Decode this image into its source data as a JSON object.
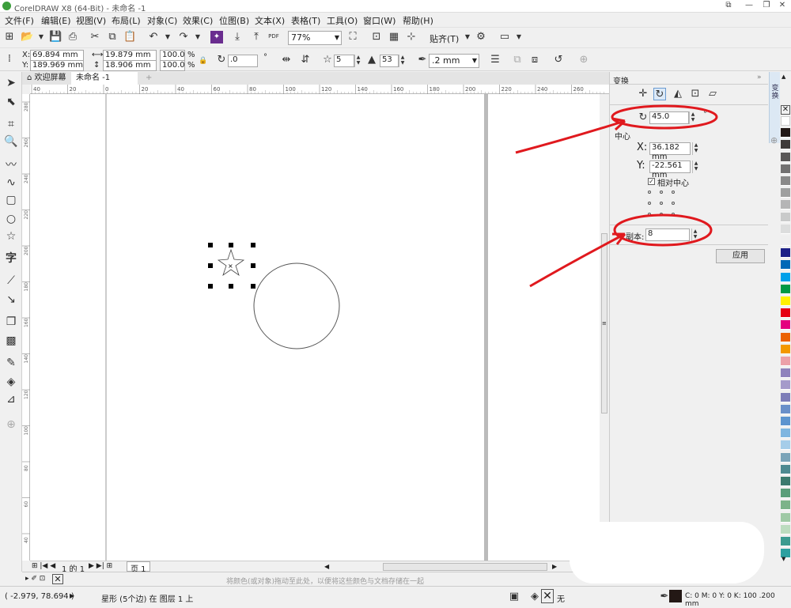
{
  "window": {
    "title": "CorelDRAW X8 (64-Bit) - 未命名 -1",
    "controls": [
      "⧉",
      "—",
      "❐",
      "✕"
    ]
  },
  "menu": {
    "items": [
      "文件(F)",
      "编辑(E)",
      "视图(V)",
      "布局(L)",
      "对象(C)",
      "效果(C)",
      "位图(B)",
      "文本(X)",
      "表格(T)",
      "工具(O)",
      "窗口(W)",
      "帮助(H)"
    ]
  },
  "standard_toolbar": {
    "zoom_value": "77%",
    "snap_label": "贴齐(T)",
    "pdf_label": "PDF"
  },
  "property_bar": {
    "x_label": "X:",
    "x_value": "69.894 mm",
    "y_label": "Y:",
    "y_value": "189.969 mm",
    "width_value": "19.879 mm",
    "height_value": "18.906 mm",
    "scale_w": "100.0",
    "scale_h": "100.0",
    "pct": "%",
    "rotation_value": ".0",
    "points_value": "5",
    "sharpness_value": "53",
    "outline_value": ".2 mm"
  },
  "tabs": {
    "welcome": "欢迎屏幕",
    "document": "未命名 -1",
    "add": "+"
  },
  "ruler": {
    "h_ticks": [
      "40",
      "20",
      "0",
      "20",
      "40",
      "60",
      "80",
      "100",
      "120",
      "140",
      "160",
      "180",
      "200",
      "220",
      "240",
      "260"
    ],
    "v_ticks": [
      "280",
      "260",
      "240",
      "220",
      "200",
      "180",
      "160",
      "140",
      "120",
      "100",
      "80",
      "60",
      "40",
      "20"
    ],
    "unit": "毫米"
  },
  "page_nav": {
    "page_of": "1 的 1",
    "page_tab": "页 1"
  },
  "status": {
    "hint": "将颜色(或对象)拖动至此处，以便将这些颜色与文档存储在一起",
    "coords": "( -2.979, 78.694 )",
    "object_info": "星形 (5个边) 在 图层 1 上",
    "fill_none": "无",
    "outline_color": "C: 0 M: 0 Y: 0 K: 100  .200 mm"
  },
  "docker": {
    "title": "变换",
    "angle_value": "45.0",
    "center_label": "中心",
    "x_label": "X:",
    "x_value": "36.182 mm",
    "y_label": "Y:",
    "y_value": "-22.561 mm",
    "relative_center_label": "相对中心",
    "copies_label": "副本:",
    "copies_value": "8",
    "apply_label": "应用",
    "side_tab_label": "变换"
  },
  "palette": {
    "colors": [
      "#ffffff",
      "#231815",
      "#3e3a39",
      "#595757",
      "#727171",
      "#898989",
      "#9fa0a0",
      "#b5b5b6",
      "#c9caca",
      "#dcdddd",
      "#efefef",
      "#1d2088",
      "#0068b7",
      "#00a0e9",
      "#009944",
      "#fff100",
      "#e60012",
      "#e4007f",
      "#eb6100",
      "#f39800",
      "#eca0a8",
      "#8f82bc",
      "#a59aca",
      "#7d7db8",
      "#6a8fc9",
      "#5d94cf",
      "#7fb6e0",
      "#a5cde9",
      "#7ba4b8",
      "#4e8a91",
      "#3b7a6e",
      "#5a9e7a",
      "#7cb389",
      "#9fc9a5",
      "#bcdcbf",
      "#3b9b90",
      "#2da0a0"
    ]
  },
  "annotations": {
    "accent": "#e0191e"
  }
}
